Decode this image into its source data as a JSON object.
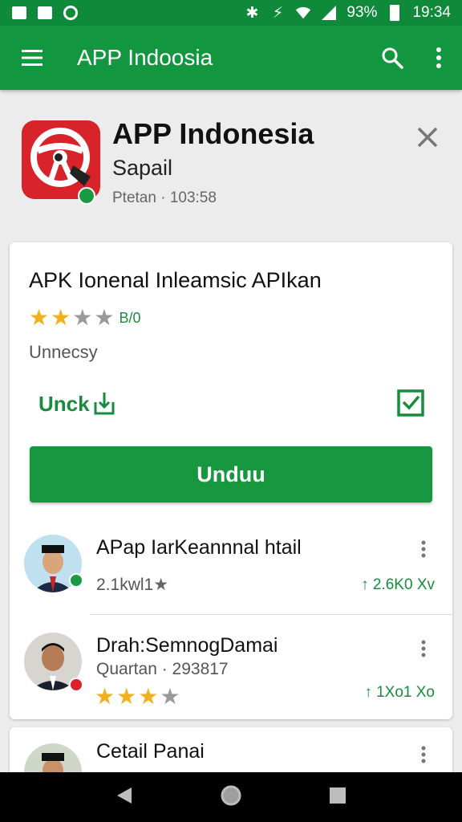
{
  "status_bar": {
    "battery": "93%",
    "time": "19:34",
    "icons": [
      "image-notification-icon",
      "drive-notification-icon",
      "whatsapp-icon",
      "bluetooth-icon",
      "alarm-icon",
      "wifi-icon",
      "signal-icon",
      "battery-icon"
    ]
  },
  "app_bar": {
    "title": "APP Indoosia",
    "icons": [
      "menu-icon",
      "search-icon",
      "more-vert-icon"
    ]
  },
  "app": {
    "name": "APP Indonesia",
    "developer": "Sapail",
    "meta": "Ptetan · 103:58",
    "icon_color": "#d8232a"
  },
  "main_card": {
    "title": "APK Ionenal Inleamsic APIkan",
    "rating": 2,
    "max_rating": 4,
    "rating_label": "B/0",
    "subtitle": "Unnecsy",
    "action_label": "Unck",
    "primary_button": "Unduu"
  },
  "list": [
    {
      "title": "APap IarKeannnal htail",
      "subtitle": "2.1kwl1",
      "subtitle_star": "★",
      "count": "2.6K0 Xv",
      "badge_color": "#1a9a44"
    },
    {
      "title": "Drah:SemnogDamai",
      "subtitle": "Quartan · 293817",
      "rating": 3,
      "max_rating": 4,
      "count": "1Xo1 Xo",
      "badge_color": "#d8232a"
    },
    {
      "title": "Cetail Panai",
      "subtitle": "",
      "count": "",
      "badge_color": ""
    }
  ],
  "colors": {
    "primary_green": "#12963f",
    "status_green": "#0f8a3a",
    "star_yellow": "#f2b01e",
    "accent_red": "#d8232a"
  }
}
